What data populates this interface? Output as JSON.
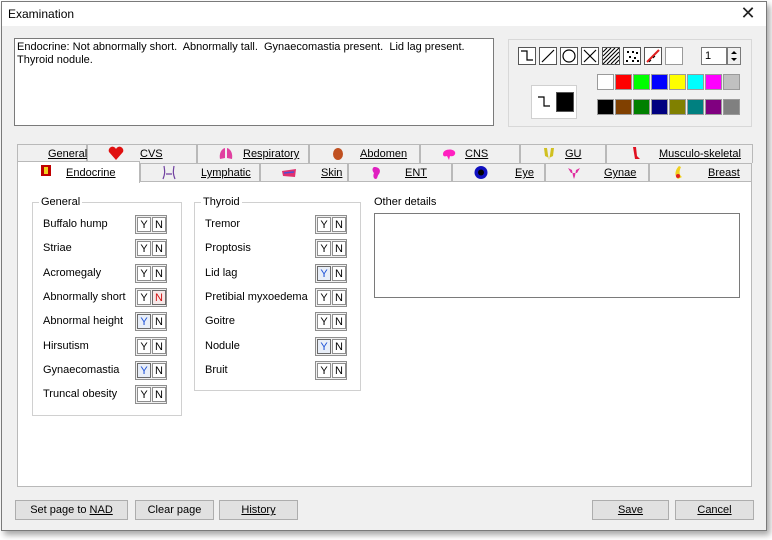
{
  "window": {
    "title": "Examination",
    "close_glyph": "✕"
  },
  "summary_text": "Endocrine: Not abnormally short.  Abnormally tall.  Gynaecomastia present.  Lid lag present.  Thyroid nodule.",
  "drawing_tools": {
    "tools": [
      "curve-tool-icon",
      "line-tool-icon",
      "circle-tool-icon",
      "cross-tool-icon",
      "hatch-tool-icon",
      "dots-tool-icon",
      "scribble-tool-icon",
      "rectangle-tool-icon"
    ],
    "line_width": "1",
    "palette_row1": [
      "#ffffff",
      "#ff0000",
      "#00ff00",
      "#0000ff",
      "#ffff00",
      "#00ffff",
      "#ff00ff",
      "#c0c0c0"
    ],
    "palette_row2": [
      "#000000",
      "#804000",
      "#008000",
      "#000080",
      "#808000",
      "#008080",
      "#800080",
      "#808080"
    ],
    "current_color": "#000000"
  },
  "tabs_back": [
    "General",
    "CVS",
    "Respiratory",
    "Abdomen",
    "CNS",
    "GU",
    "Musculo-skeletal"
  ],
  "tabs_front": [
    "Endocrine",
    "Lymphatic",
    "Skin",
    "ENT",
    "Eye",
    "Gynae",
    "Breast"
  ],
  "general_group": {
    "title": "General",
    "rows": [
      {
        "label": "Buffalo hump",
        "value": ""
      },
      {
        "label": "Striae",
        "value": ""
      },
      {
        "label": "Acromegaly",
        "value": ""
      },
      {
        "label": "Abnormally short",
        "value": "N"
      },
      {
        "label": "Abnormal height",
        "value": "Y"
      },
      {
        "label": "Hirsutism",
        "value": ""
      },
      {
        "label": "Gynaecomastia",
        "value": "Y"
      },
      {
        "label": "Truncal obesity",
        "value": ""
      }
    ]
  },
  "thyroid_group": {
    "title": "Thyroid",
    "rows": [
      {
        "label": "Tremor",
        "value": ""
      },
      {
        "label": "Proptosis",
        "value": ""
      },
      {
        "label": "Lid lag",
        "value": "Y"
      },
      {
        "label": "Pretibial myxoedema",
        "value": ""
      },
      {
        "label": "Goitre",
        "value": ""
      },
      {
        "label": "Nodule",
        "value": "Y"
      },
      {
        "label": "Bruit",
        "value": ""
      }
    ]
  },
  "yn": {
    "yes": "Y",
    "no": "N"
  },
  "other_details": {
    "label": "Other details",
    "value": ""
  },
  "buttons": {
    "set_nad_prefix": "Set page to ",
    "set_nad_key": "NAD",
    "clear": "Clear page",
    "history": "History",
    "save": "Save",
    "cancel": "Cancel"
  }
}
